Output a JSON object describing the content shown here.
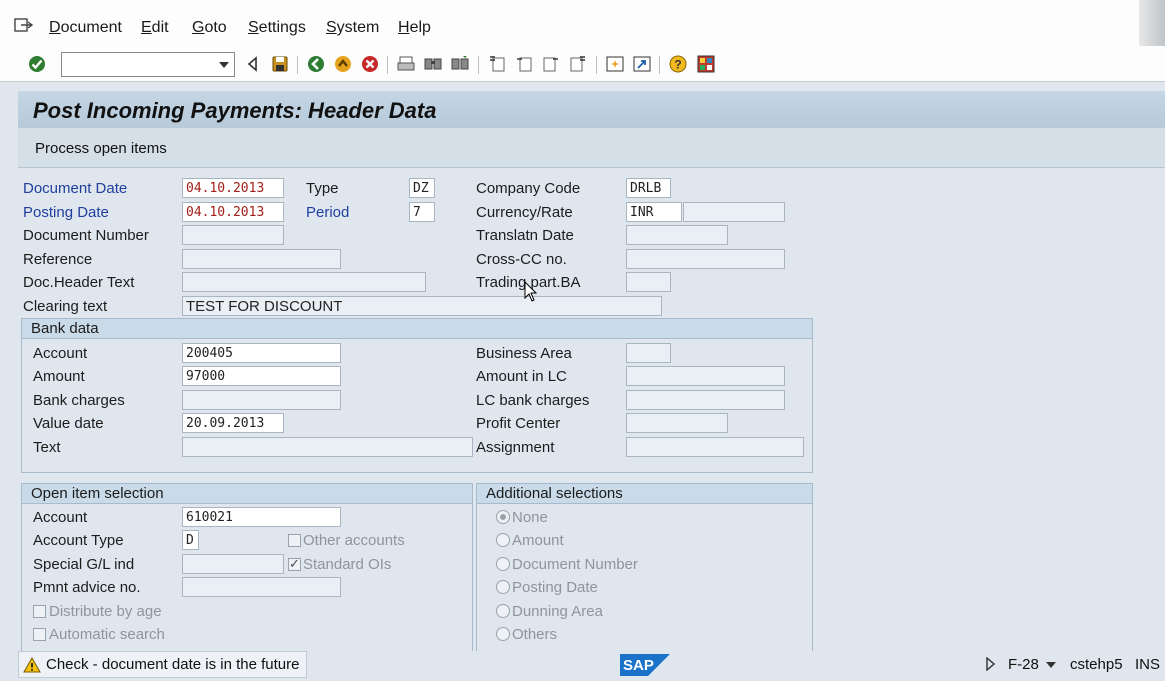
{
  "menu": [
    "Document",
    "Edit",
    "Goto",
    "Settings",
    "System",
    "Help"
  ],
  "title": "Post Incoming Payments: Header Data",
  "appbar": {
    "process_open_items": "Process open items"
  },
  "header": {
    "document_date": {
      "label": "Document Date",
      "value": "04.10.2013"
    },
    "posting_date": {
      "label": "Posting Date",
      "value": "04.10.2013"
    },
    "document_number": {
      "label": "Document Number",
      "value": ""
    },
    "reference": {
      "label": "Reference",
      "value": ""
    },
    "doc_header_text": {
      "label": "Doc.Header Text",
      "value": ""
    },
    "clearing_text": {
      "label": "Clearing text",
      "value": "TEST FOR DISCOUNT"
    },
    "type": {
      "label": "Type",
      "value": "DZ"
    },
    "period": {
      "label": "Period",
      "value": "7"
    },
    "company_code": {
      "label": "Company Code",
      "value": "DRLB"
    },
    "currency_rate": {
      "label": "Currency/Rate",
      "value": "INR",
      "rate": ""
    },
    "translatn_date": {
      "label": "Translatn Date",
      "value": ""
    },
    "cross_cc": {
      "label": "Cross-CC no.",
      "value": ""
    },
    "trading_part_ba": {
      "label": "Trading part.BA",
      "value": ""
    }
  },
  "bank_data": {
    "title": "Bank data",
    "account": {
      "label": "Account",
      "value": "200405"
    },
    "amount": {
      "label": "Amount",
      "value": "97000"
    },
    "bank_charges": {
      "label": "Bank charges",
      "value": ""
    },
    "value_date": {
      "label": "Value date",
      "value": "20.09.2013"
    },
    "text": {
      "label": "Text",
      "value": ""
    },
    "business_area": {
      "label": "Business Area",
      "value": ""
    },
    "amount_in_lc": {
      "label": "Amount in LC",
      "value": ""
    },
    "lc_bank_charges": {
      "label": "LC bank charges",
      "value": ""
    },
    "profit_center": {
      "label": "Profit Center",
      "value": ""
    },
    "assignment": {
      "label": "Assignment",
      "value": ""
    }
  },
  "open_item_selection": {
    "title": "Open item selection",
    "account": {
      "label": "Account",
      "value": "610021"
    },
    "account_type": {
      "label": "Account Type",
      "value": "D"
    },
    "special_gl_ind": {
      "label": "Special G/L ind",
      "value": ""
    },
    "pmnt_advice_no": {
      "label": "Pmnt advice no.",
      "value": ""
    },
    "other_accounts": {
      "label": "Other accounts",
      "checked": false
    },
    "standard_ois": {
      "label": "Standard OIs",
      "checked": true
    },
    "distribute_by_age": {
      "label": "Distribute by age",
      "checked": false
    },
    "automatic_search": {
      "label": "Automatic search",
      "checked": false
    }
  },
  "additional_selections": {
    "title": "Additional selections",
    "options": [
      "None",
      "Amount",
      "Document Number",
      "Posting Date",
      "Dunning Area",
      "Others"
    ],
    "selected": "None"
  },
  "status": {
    "message": "Check - document date is in the future",
    "transaction": "F-28",
    "server": "cstehp5",
    "mode": "INS"
  },
  "colors": {
    "required": "#a3201a",
    "label_blue": "#1f3f9e",
    "group_header": "#c9dae8"
  }
}
